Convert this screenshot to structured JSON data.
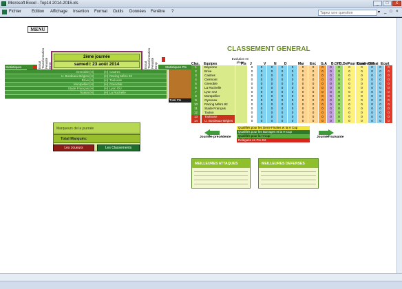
{
  "window": {
    "title": "Microsoft Excel - Top14 2014-2015.xls",
    "min": "_",
    "max": "□",
    "close": "X"
  },
  "menu": {
    "items": [
      "Fichier",
      "Edition",
      "Affichage",
      "Insertion",
      "Format",
      "Outils",
      "Données",
      "Fenêtre",
      "?"
    ],
    "help_placeholder": "Tapez une question",
    "help_arrow": "▾",
    "mdi": [
      "_",
      "□",
      "×"
    ]
  },
  "sheet": {
    "menu_button": "MENU",
    "journee": {
      "title": "2ème journée",
      "date": "samedi: 23 août 2014"
    },
    "left_vertical_labels": [
      "Essai",
      "Transformation",
      "Pénalité",
      "Drop",
      "Pénalité"
    ],
    "right_vertical_labels": [
      "Essai",
      "Transformation",
      "Pénalité",
      "Drop",
      "Pénalité"
    ],
    "left_header": "Statistiques",
    "right_header": "Statistiques Pts",
    "total_label": "Total Pts",
    "matches": [
      {
        "home": "Grenoble",
        "home_code": "(H)",
        "away_code": "(H)",
        "away": "Castres"
      },
      {
        "home": "U. Bordeaux-Bègles",
        "home_code": "(H)",
        "away_code": "(H)",
        "away": "Racing Métro 92"
      },
      {
        "home": "Brive",
        "home_code": "(H)",
        "away_code": "(H)",
        "away": "Toulouse"
      },
      {
        "home": "Montpellier",
        "home_code": "(H)",
        "away_code": "(H)",
        "away": "Grenoble"
      },
      {
        "home": "Stade Français",
        "home_code": "(H)",
        "away_code": "(H)",
        "away": "Lyon OU"
      },
      {
        "home": "Toulon",
        "home_code": "(H)",
        "away_code": "(H)",
        "away": "La Rochelle"
      },
      {
        "home": "",
        "home_code": "",
        "away_code": "",
        "away": ""
      }
    ],
    "marqueurs": {
      "top": "Marqueurs de la journée",
      "total": "Total Marqués:"
    },
    "btn_joueurs": "Les Joueurs",
    "btn_classements": "Les Classements"
  },
  "classement": {
    "title": "CLASSEMENT GENERAL",
    "evolution_label": "Evolution en place",
    "headers": [
      "Clas.",
      "Equipes",
      "Pts",
      "J",
      "V",
      "N",
      "D",
      "Mar",
      "Enc",
      "G.A",
      "B.Off",
      "B.Def",
      "Pour Essai",
      "Contre Essai",
      "Diff",
      "Ecart"
    ],
    "rows": [
      {
        "rank": "1",
        "team": "Bayonne"
      },
      {
        "rank": "2",
        "team": "Brive"
      },
      {
        "rank": "3",
        "team": "Castres"
      },
      {
        "rank": "4",
        "team": "Clermont"
      },
      {
        "rank": "5",
        "team": "Grenoble"
      },
      {
        "rank": "6",
        "team": "La Rochelle"
      },
      {
        "rank": "7",
        "team": "Lyon OU"
      },
      {
        "rank": "8",
        "team": "Montpellier"
      },
      {
        "rank": "9",
        "team": "Oyonnax"
      },
      {
        "rank": "10",
        "team": "Racing Métro 92"
      },
      {
        "rank": "11",
        "team": "Stade Français"
      },
      {
        "rank": "12",
        "team": "Toulon"
      },
      {
        "rank": "13",
        "team": "Toulouse"
      },
      {
        "rank": "14",
        "team": "U. Bordeaux-Bègles"
      }
    ],
    "zero": "0",
    "legend": [
      {
        "text": "Qualifiés pour les Demi-Finales et la H Cup",
        "color": "#f0e63c"
      },
      {
        "text": "Qualifiés pour les Barrages et la H Cup",
        "color": "#2f7a2a"
      },
      {
        "text": "Qualifiés pour la H Cup",
        "color": "#5cae3a"
      },
      {
        "text": "Relégués en Pro D2",
        "color": "#d7271d"
      }
    ],
    "nav_prev": "Journée précédente",
    "nav_next": "Journée suivante"
  },
  "panels": {
    "attaques": "MEILLEURES ATTAQUES",
    "defenses": "MEILLEURES DEFENSES"
  },
  "colors": {
    "rank_green": "#4f9a2c",
    "rank_red": "#c8321f",
    "team_bg": "#d9ea8a",
    "pts_bg": "#ffffff",
    "jvnd_bg": "#7fd3f2",
    "mar_bg": "#ffd48f",
    "enc_bg": "#ffd48f",
    "ga_bg": "#f7a23a",
    "boff_bg": "#c5a0e0",
    "bdef_bg": "#9edc6a",
    "pe_bg": "#fff27a",
    "ce_bg": "#fff27a",
    "diff_bg": "#8fd0ef",
    "ecart_bg": "#e23b2b"
  }
}
